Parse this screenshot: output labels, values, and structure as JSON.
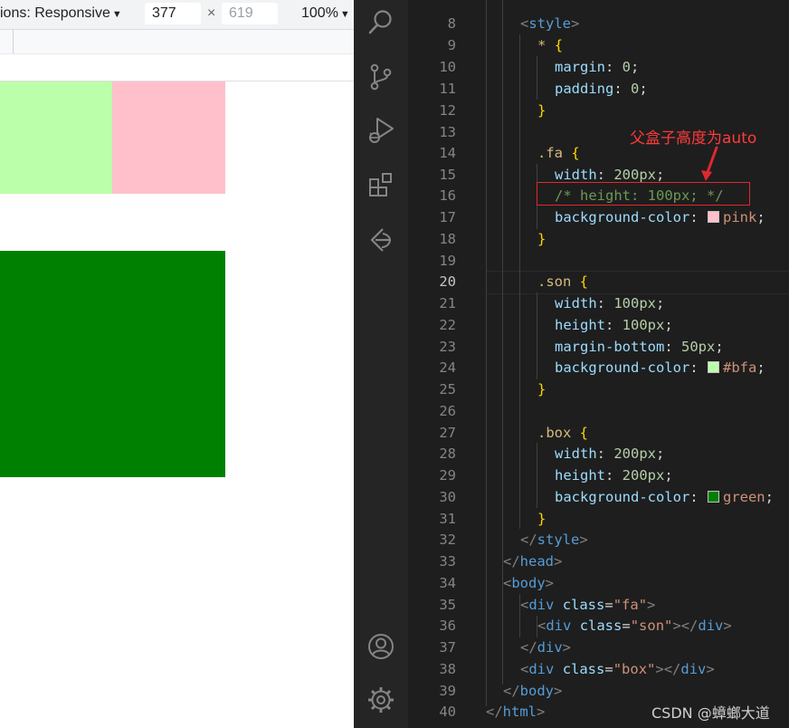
{
  "browser": {
    "dimensions_label": "ions: Responsive",
    "width_value": "377",
    "height_placeholder": "619",
    "times_symbol": "×",
    "zoom_label": "100%",
    "caret": "▼"
  },
  "preview": {
    "son_color": "#bbffaa",
    "fa_color": "#ffc0cb",
    "box_color": "#008000"
  },
  "activity_bar": {
    "icons": [
      "search-icon",
      "source-control-icon",
      "run-debug-icon",
      "extensions-icon",
      "remote-explorer-icon",
      "account-icon",
      "manage-gear-icon"
    ]
  },
  "editor": {
    "active_line": "20",
    "lines": [
      {
        "n": "8"
      },
      {
        "n": "9"
      },
      {
        "n": "10"
      },
      {
        "n": "11"
      },
      {
        "n": "12"
      },
      {
        "n": "13"
      },
      {
        "n": "14"
      },
      {
        "n": "15"
      },
      {
        "n": "16"
      },
      {
        "n": "17"
      },
      {
        "n": "18"
      },
      {
        "n": "19"
      },
      {
        "n": "20"
      },
      {
        "n": "21"
      },
      {
        "n": "22"
      },
      {
        "n": "23"
      },
      {
        "n": "24"
      },
      {
        "n": "25"
      },
      {
        "n": "26"
      },
      {
        "n": "27"
      },
      {
        "n": "28"
      },
      {
        "n": "29"
      },
      {
        "n": "30"
      },
      {
        "n": "31"
      },
      {
        "n": "32"
      },
      {
        "n": "33"
      },
      {
        "n": "34"
      },
      {
        "n": "35"
      },
      {
        "n": "36"
      },
      {
        "n": "37"
      },
      {
        "n": "38"
      },
      {
        "n": "39"
      },
      {
        "n": "40"
      }
    ],
    "code": {
      "l8_open": "<",
      "l8_tag": "style",
      "l8_close": ">",
      "l9_sel": "*",
      "l9_brace": "{",
      "l10_prop": "margin",
      "l10_colon": ": ",
      "l10_num": "0",
      "l10_semi": ";",
      "l11_prop": "padding",
      "l11_colon": ": ",
      "l11_num": "0",
      "l11_semi": ";",
      "l12_brace": "}",
      "l14_sel": ".fa",
      "l14_brace": "{",
      "l15_prop": "width",
      "l15_colon": ": ",
      "l15_num": "200px",
      "l15_semi": ";",
      "l16_cmt": "/* height: 100px; */",
      "l17_prop": "background-color",
      "l17_colon": ": ",
      "l17_val": "pink",
      "l17_semi": ";",
      "l18_brace": "}",
      "l20_sel": ".son",
      "l20_brace": "{",
      "l21_prop": "width",
      "l21_colon": ": ",
      "l21_num": "100px",
      "l21_semi": ";",
      "l22_prop": "height",
      "l22_colon": ": ",
      "l22_num": "100px",
      "l22_semi": ";",
      "l23_prop": "margin-bottom",
      "l23_colon": ": ",
      "l23_num": "50px",
      "l23_semi": ";",
      "l24_prop": "background-color",
      "l24_colon": ": ",
      "l24_val": "#bfa",
      "l24_semi": ";",
      "l25_brace": "}",
      "l27_sel": ".box",
      "l27_brace": "{",
      "l28_prop": "width",
      "l28_colon": ": ",
      "l28_num": "200px",
      "l28_semi": ";",
      "l29_prop": "height",
      "l29_colon": ": ",
      "l29_num": "200px",
      "l29_semi": ";",
      "l30_prop": "background-color",
      "l30_colon": ": ",
      "l30_val": "green",
      "l30_semi": ";",
      "l31_brace": "}",
      "l32_open": "</",
      "l32_tag": "style",
      "l32_close": ">",
      "l33_open": "</",
      "l33_tag": "head",
      "l33_close": ">",
      "l34_open": "<",
      "l34_tag": "body",
      "l34_close": ">",
      "l35_open": "<",
      "l35_tag": "div",
      "l35_attr": "class",
      "l35_eq": "=",
      "l35_str": "\"fa\"",
      "l35_close": ">",
      "l36_open": "<",
      "l36_tag": "div",
      "l36_attr": "class",
      "l36_eq": "=",
      "l36_str": "\"son\"",
      "l36_close": "></",
      "l36_tag2": "div",
      "l36_close2": ">",
      "l37_open": "</",
      "l37_tag": "div",
      "l37_close": ">",
      "l38_open": "<",
      "l38_tag": "div",
      "l38_attr": "class",
      "l38_eq": "=",
      "l38_str": "\"box\"",
      "l38_close": "></",
      "l38_tag2": "div",
      "l38_close2": ">",
      "l39_open": "</",
      "l39_tag": "body",
      "l39_close": ">",
      "l40_open": "</",
      "l40_tag": "html",
      "l40_close": ">"
    },
    "swatches": {
      "pink": "#ffc0cb",
      "bfa": "#bbffaa",
      "green": "#008000"
    }
  },
  "annotation": {
    "text": "父盒子高度为auto",
    "color": "#e0282e"
  },
  "watermark": "CSDN @蟑螂大道"
}
